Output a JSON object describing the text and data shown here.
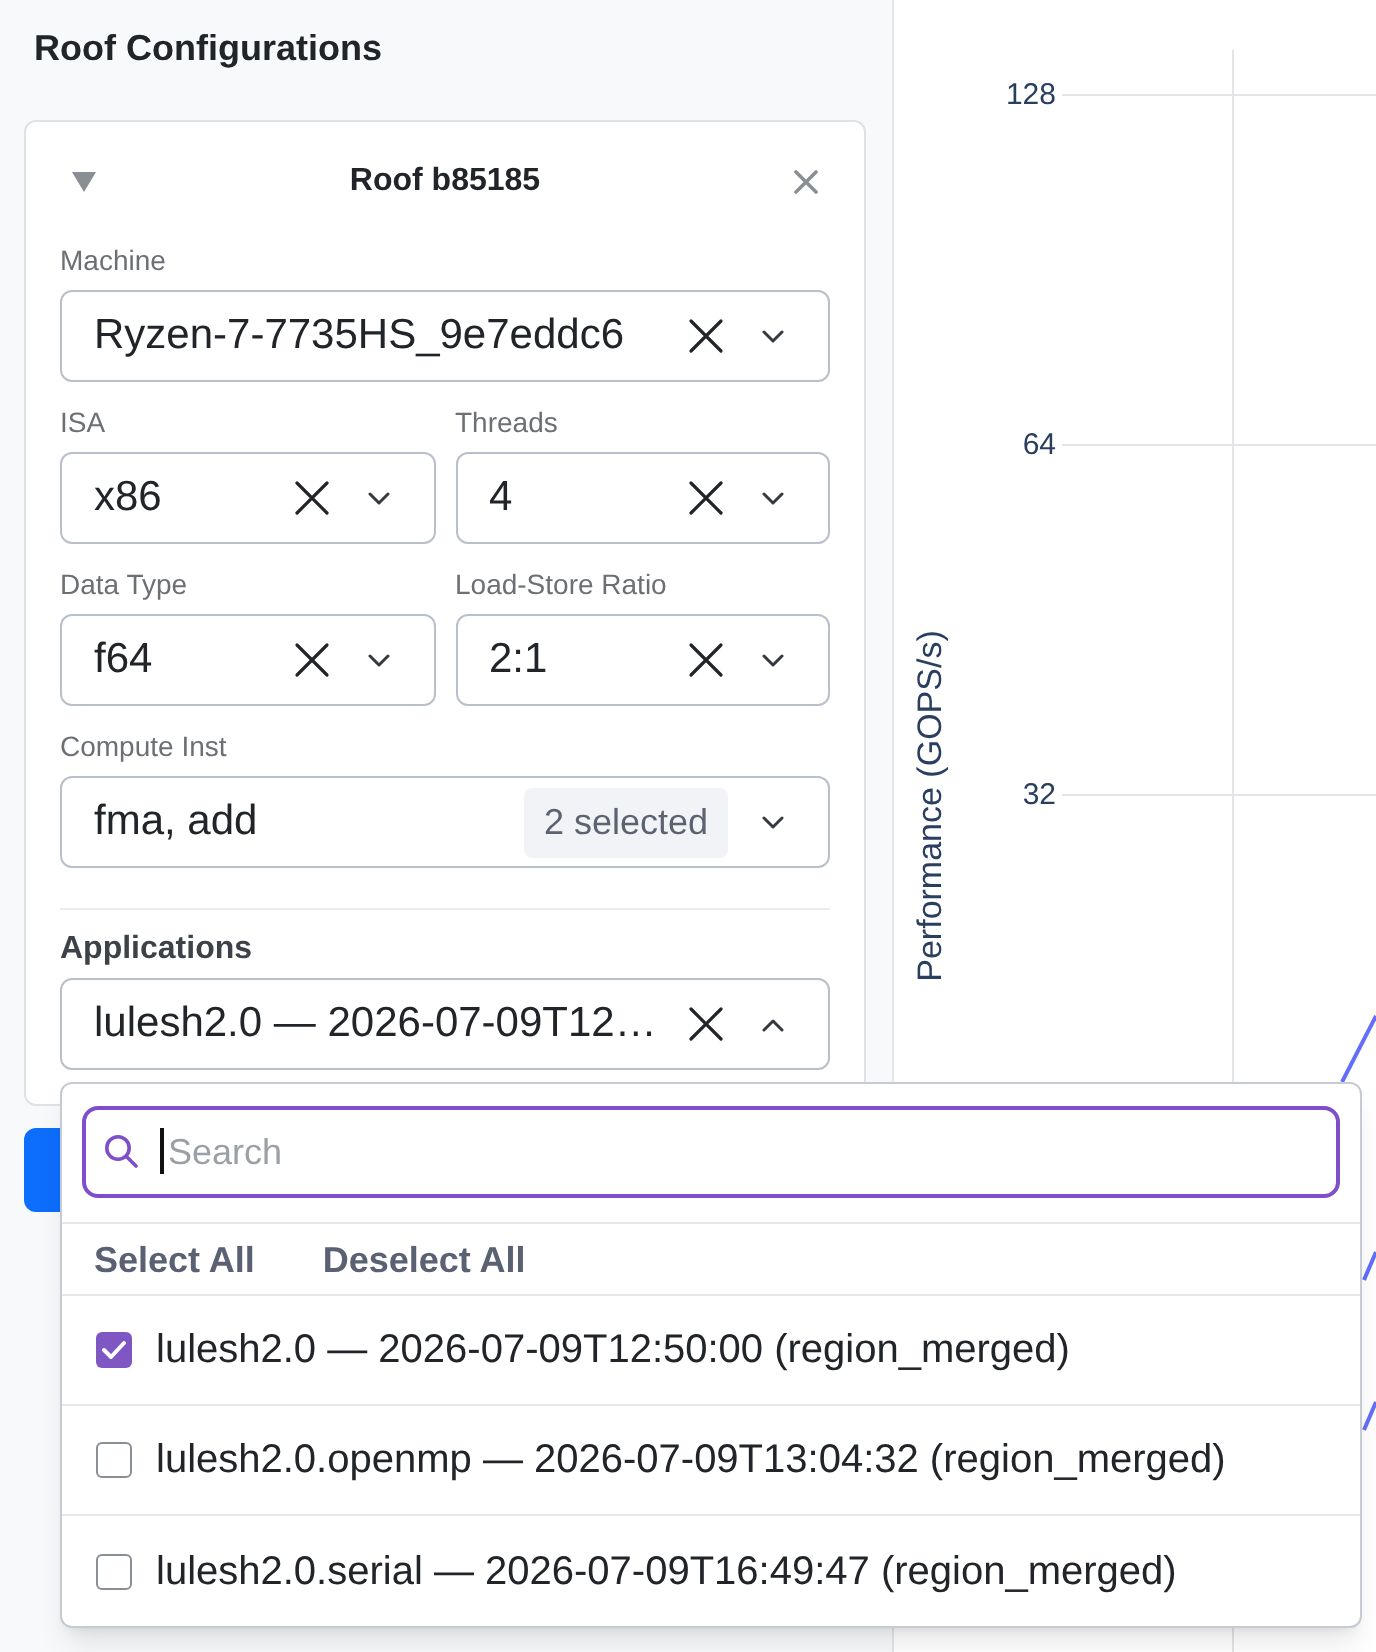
{
  "sidebar": {
    "title": "Roof Configurations",
    "roof": {
      "title": "Roof b85185",
      "expanded": true,
      "field_rows": [
        [
          {
            "label": "Machine",
            "value": "Ryzen-7-7735HS_9e7eddc6",
            "clearable": true,
            "open": false
          }
        ],
        [
          {
            "label": "ISA",
            "value": "x86",
            "clearable": true,
            "open": false
          },
          {
            "label": "Threads",
            "value": "4",
            "clearable": true,
            "open": false
          }
        ],
        [
          {
            "label": "Data Type",
            "value": "f64",
            "clearable": true,
            "open": false
          },
          {
            "label": "Load-Store Ratio",
            "value": "2:1",
            "clearable": true,
            "open": false
          }
        ],
        [
          {
            "label": "Compute Inst",
            "value": "fma, add",
            "badge": "2 selected",
            "clearable": false,
            "open": false
          }
        ]
      ],
      "applications": {
        "label": "Applications",
        "value": "lulesh2.0 — 2026-07-09T12…",
        "clearable": true,
        "open": true
      }
    }
  },
  "applications_menu": {
    "search": {
      "placeholder": "Search"
    },
    "actions": [
      "Select All",
      "Deselect All"
    ],
    "options": [
      {
        "label": "lulesh2.0 — 2026-07-09T12:50:00 (region_merged)",
        "checked": true
      },
      {
        "label": "lulesh2.0.openmp — 2026-07-09T13:04:32 (region_merged)",
        "checked": false
      },
      {
        "label": "lulesh2.0.serial — 2026-07-09T16:49:47 (region_merged)",
        "checked": false
      }
    ]
  },
  "chart": {
    "y_axis": {
      "title": "Performance (GOPS/s)",
      "tick_labels": [
        "128",
        "64",
        "32"
      ]
    }
  }
}
